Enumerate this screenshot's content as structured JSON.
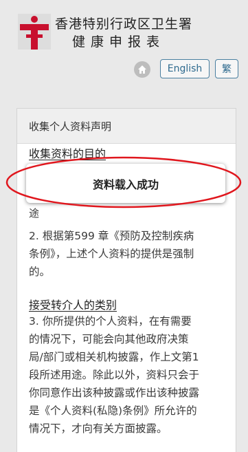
{
  "header": {
    "title_line1": "香港特别行政区卫生署",
    "title_line2": "健康申报表",
    "lang_english": "English",
    "lang_traditional": "繁"
  },
  "panel": {
    "heading": "收集个人资料声明",
    "section1_title": "收集资料的目的",
    "cut_line_text": "途",
    "para2_lines": [
      "2. 根据第599 章《预防及控制疾病",
      "条例》，上述个人资料的提供是强制",
      "的。"
    ],
    "section2_title": "接受转介人的类别",
    "para3_lines": [
      "3. 你所提供的个人资料，在有需要",
      "的情况下，可能会向其他政府决策",
      "局/部门或相关机构披露，作上文第1",
      "段所述用途。除此以外，资料只会于",
      "你同意作出该种披露或作出该种披露",
      "是《个人资料(私隐)条例》所允许的",
      "情况下，才向有关方面披露。"
    ]
  },
  "toast": {
    "message": "资料载入成功"
  },
  "colors": {
    "accent": "#c8102e",
    "button_border": "#4a7fa0",
    "annotation": "#e0161d"
  }
}
